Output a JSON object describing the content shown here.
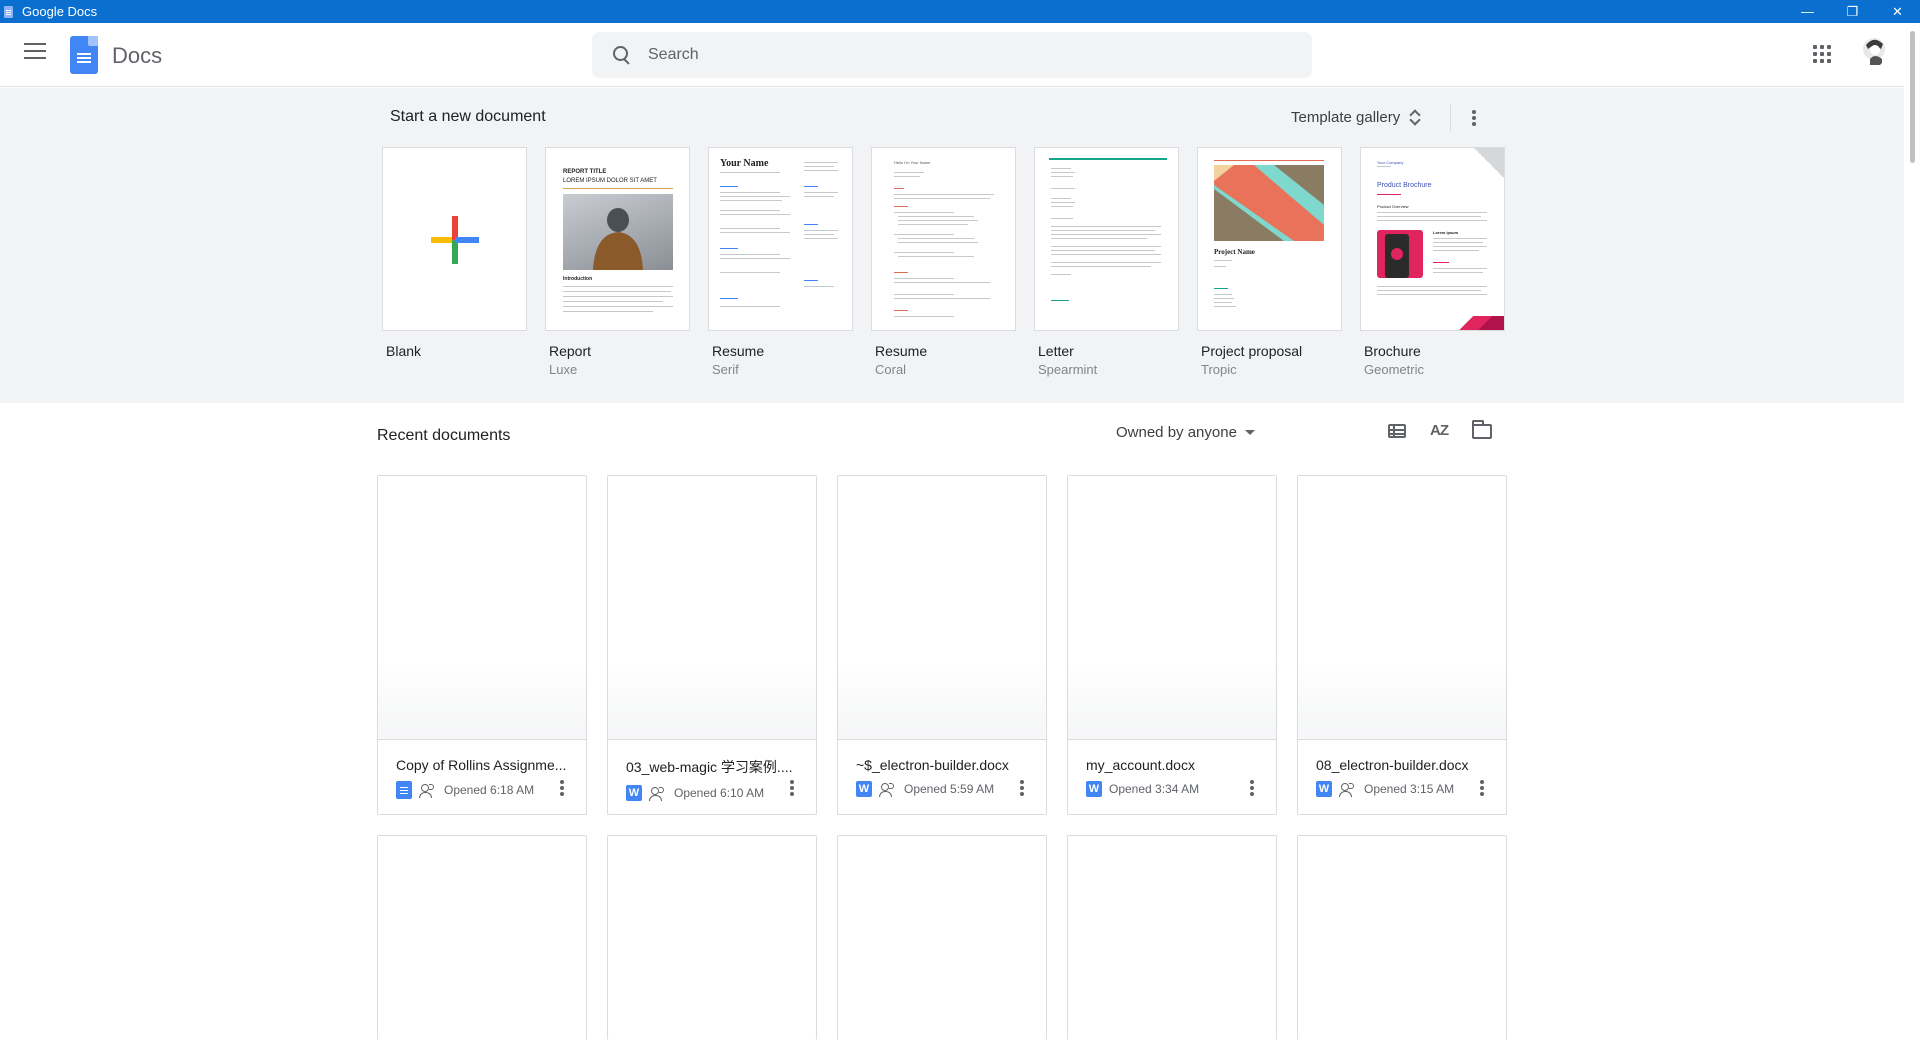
{
  "window": {
    "title": "Google Docs",
    "minimize": "—",
    "restore": "❐",
    "close": "✕"
  },
  "header": {
    "app_name": "Docs",
    "search_placeholder": "Search"
  },
  "templates": {
    "heading": "Start a new document",
    "gallery_label": "Template gallery",
    "items": [
      {
        "name": "Blank",
        "sub": ""
      },
      {
        "name": "Report",
        "sub": "Luxe",
        "thumb_title": "REPORT TITLE",
        "thumb_subtitle": "LOREM IPSUM DOLOR SIT AMET",
        "thumb_section": "Introduction"
      },
      {
        "name": "Resume",
        "sub": "Serif",
        "thumb_title": "Your Name"
      },
      {
        "name": "Resume",
        "sub": "Coral",
        "thumb_title": "Hello I'm Your Name"
      },
      {
        "name": "Letter",
        "sub": "Spearmint"
      },
      {
        "name": "Project proposal",
        "sub": "Tropic",
        "thumb_title": "Project Name"
      },
      {
        "name": "Brochure",
        "sub": "Geometric",
        "thumb_company": "Your Company",
        "thumb_title": "Product Brochure",
        "thumb_section": "Product Overview",
        "thumb_section2": "Lorem ipsum"
      }
    ]
  },
  "recent": {
    "heading": "Recent documents",
    "owner_filter": "Owned by anyone",
    "sort_label": "AZ",
    "docs": [
      {
        "name": "Copy of Rollins Assignme...",
        "type": "gdoc",
        "opened": "Opened 6:18 AM"
      },
      {
        "name": "03_web-magic 学习案例....",
        "type": "W",
        "opened": "Opened 6:10 AM"
      },
      {
        "name": "~$_electron-builder.docx",
        "type": "W",
        "opened": "Opened 5:59 AM"
      },
      {
        "name": "my_account.docx",
        "type": "W",
        "opened": "Opened 3:34 AM"
      },
      {
        "name": "08_electron-builder.docx",
        "type": "W",
        "opened": "Opened 3:15 AM"
      }
    ]
  },
  "colors": {
    "titlebar": "#0b6fcf",
    "brand_blue": "#4285f4",
    "section_bg": "#f1f3f4"
  }
}
